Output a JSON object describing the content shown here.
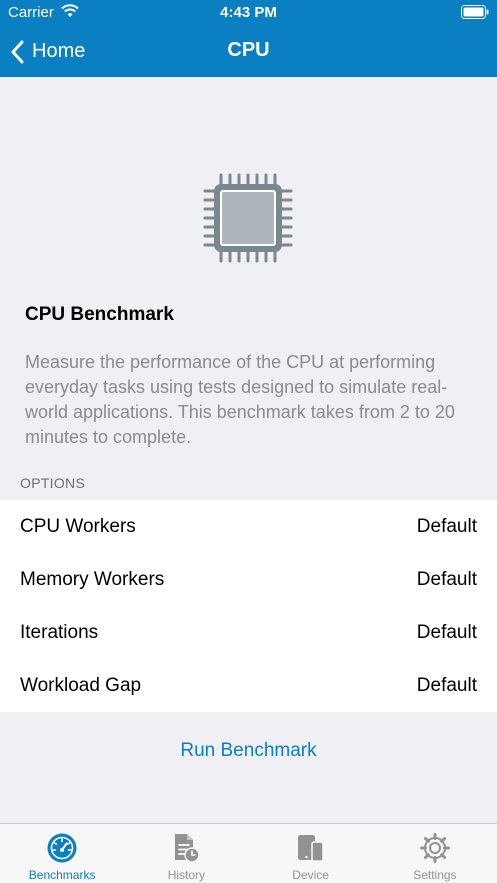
{
  "status_bar": {
    "carrier": "Carrier",
    "time": "4:43 PM"
  },
  "nav": {
    "back_label": "Home",
    "title": "CPU"
  },
  "benchmark": {
    "icon": "cpu-chip-icon",
    "title": "CPU Benchmark",
    "description": "Measure the performance of the CPU at performing everyday tasks using tests designed to simulate real-world applications. This benchmark takes from 2 to 20 minutes to complete."
  },
  "options": {
    "header": "OPTIONS",
    "rows": [
      {
        "label": "CPU Workers",
        "value": "Default"
      },
      {
        "label": "Memory Workers",
        "value": "Default"
      },
      {
        "label": "Iterations",
        "value": "Default"
      },
      {
        "label": "Workload Gap",
        "value": "Default"
      }
    ]
  },
  "run_button": "Run Benchmark",
  "tabs": [
    {
      "label": "Benchmarks",
      "icon": "speedometer-icon",
      "active": true
    },
    {
      "label": "History",
      "icon": "history-document-icon",
      "active": false
    },
    {
      "label": "Device",
      "icon": "device-icon",
      "active": false
    },
    {
      "label": "Settings",
      "icon": "gear-icon",
      "active": false
    }
  ],
  "colors": {
    "accent": "#0a7fc1",
    "background": "#efeff4",
    "tab_inactive": "#929292"
  }
}
